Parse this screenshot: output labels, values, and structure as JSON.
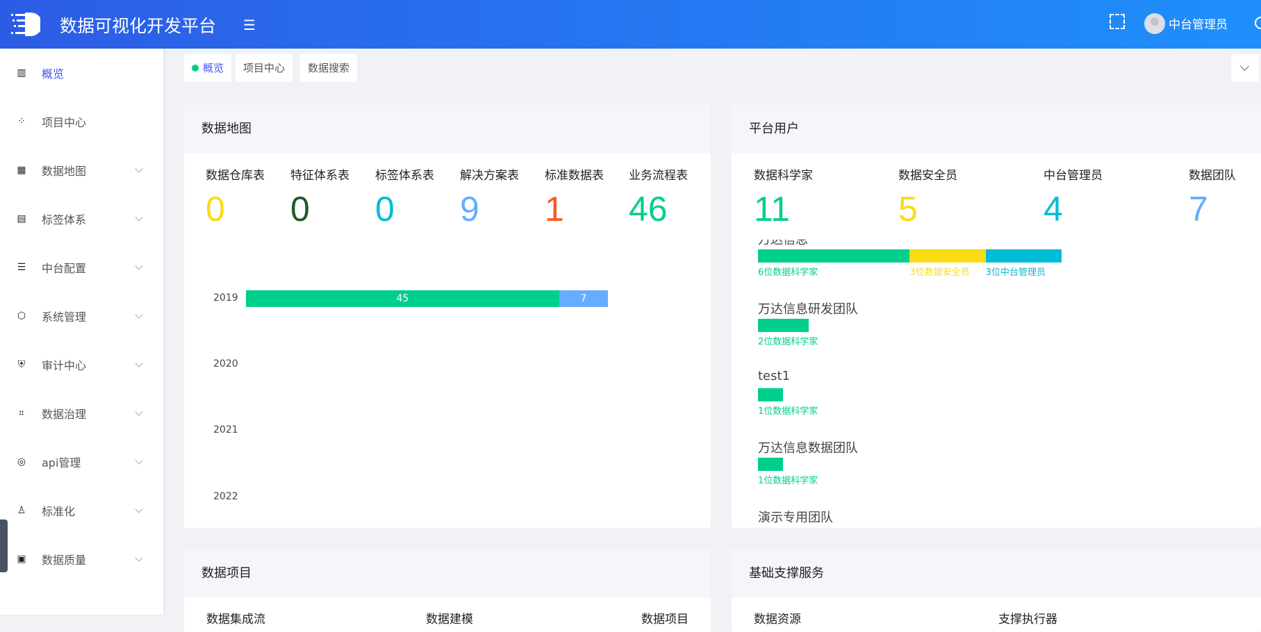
{
  "header": {
    "title": "数据可视化开发平台",
    "user": "中台管理员"
  },
  "sidebar": {
    "items": [
      {
        "label": "概览",
        "icon": "bar-chart-icon",
        "active": true
      },
      {
        "label": "项目中心",
        "icon": "grid-icon"
      },
      {
        "label": "数据地图",
        "icon": "building-icon",
        "expand": true
      },
      {
        "label": "标签体系",
        "icon": "table-icon",
        "expand": true
      },
      {
        "label": "中台配置",
        "icon": "sliders-icon",
        "expand": true
      },
      {
        "label": "系统管理",
        "icon": "hexagon-icon",
        "expand": true
      },
      {
        "label": "审计中心",
        "icon": "shield-user-icon",
        "expand": true
      },
      {
        "label": "数据治理",
        "icon": "code-file-icon",
        "expand": true
      },
      {
        "label": "api管理",
        "icon": "target-icon",
        "expand": true
      },
      {
        "label": "标准化",
        "icon": "user-gear-icon",
        "expand": true
      },
      {
        "label": "数据质量",
        "icon": "dashboard-icon",
        "expand": true
      }
    ]
  },
  "tabs": [
    {
      "label": "概览",
      "active": true
    },
    {
      "label": "项目中心"
    },
    {
      "label": "数据搜索"
    }
  ],
  "data_map": {
    "title": "数据地图",
    "stats": [
      {
        "label": "数据仓库表",
        "value": "0",
        "color": "#fadb14"
      },
      {
        "label": "特征体系表",
        "value": "0",
        "color": "#1f5a25"
      },
      {
        "label": "标签体系表",
        "value": "0",
        "color": "#00bcd4"
      },
      {
        "label": "解决方案表",
        "value": "9",
        "color": "#65adff"
      },
      {
        "label": "标准数据表",
        "value": "1",
        "color": "#ff5722"
      },
      {
        "label": "业务流程表",
        "value": "46",
        "color": "#00ce8d"
      }
    ]
  },
  "chart_data": {
    "type": "bar",
    "orientation": "horizontal",
    "stacked": true,
    "categories": [
      "2019",
      "2020",
      "2021",
      "2022"
    ],
    "series": [
      {
        "values": [
          45,
          0,
          0,
          0
        ],
        "color": "#00ce8d"
      },
      {
        "values": [
          7,
          0,
          0,
          0
        ],
        "color": "#65adff"
      }
    ],
    "xlim": [
      0,
      60
    ]
  },
  "platform_users": {
    "title": "平台用户",
    "stats": [
      {
        "label": "数据科学家",
        "value": "11",
        "color": "#00ce8d"
      },
      {
        "label": "数据安全员",
        "value": "5",
        "color": "#fadb14"
      },
      {
        "label": "中台管理员",
        "value": "4",
        "color": "#00bcd4"
      },
      {
        "label": "数据团队",
        "value": "7",
        "color": "#65adff"
      }
    ],
    "teams": [
      {
        "name": "万达信息",
        "segments": [
          {
            "count": 6,
            "label": "6位数据科学家",
            "color": "#00ce8d"
          },
          {
            "count": 3,
            "label": "3位数据安全员",
            "color": "#fadb14"
          },
          {
            "count": 3,
            "label": "3位中台管理员",
            "color": "#00bcd4"
          }
        ]
      },
      {
        "name": "万达信息研发团队",
        "segments": [
          {
            "count": 2,
            "label": "2位数据科学家",
            "color": "#00ce8d"
          }
        ]
      },
      {
        "name": "test1",
        "segments": [
          {
            "count": 1,
            "label": "1位数据科学家",
            "color": "#00ce8d"
          }
        ]
      },
      {
        "name": "万达信息数据团队",
        "segments": [
          {
            "count": 1,
            "label": "1位数据科学家",
            "color": "#00ce8d"
          }
        ]
      },
      {
        "name": "演示专用团队",
        "segments": []
      }
    ]
  },
  "data_projects": {
    "title": "数据项目",
    "labels": [
      "数据集成流",
      "数据建模",
      "数据项目"
    ]
  },
  "base_services": {
    "title": "基础支撑服务",
    "labels": [
      "数据资源",
      "支撑执行器"
    ]
  }
}
